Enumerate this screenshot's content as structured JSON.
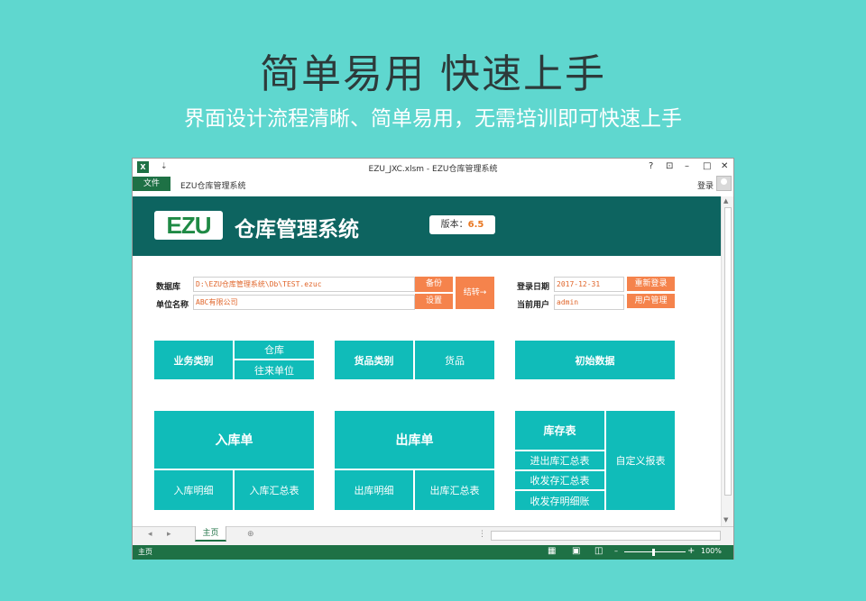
{
  "promo": {
    "headline": "简单易用  快速上手",
    "subline": "界面设计流程清晰、简单易用，无需培训即可快速上手"
  },
  "window": {
    "app_icon": "X",
    "quick_access": "⇣",
    "title": "EZU_JXC.xlsm - EZU仓库管理系统",
    "controls": {
      "help": "?",
      "ribbon_display": "⊡",
      "minimize": "–",
      "maximize": "□",
      "close": "✕"
    }
  },
  "ribbon": {
    "file_tab": "文件",
    "custom_tab": "EZU仓库管理系统",
    "login_label": "登录"
  },
  "banner": {
    "logo_text": "EZU",
    "title": "仓库管理系统",
    "version_label": "版本：",
    "version_value": "6.5"
  },
  "form": {
    "db_label": "数据库",
    "db_value": "D:\\EZU仓库管理系统\\Db\\TEST.ezuc",
    "company_label": "单位名称",
    "company_value": "ABC有限公司",
    "backup_btn": "备份",
    "settings_btn": "设置",
    "close_period_btn": "结转→",
    "login_date_label": "登录日期",
    "login_date_value": "2017-12-31",
    "current_user_label": "当前用户",
    "current_user_value": "admin",
    "relogin_btn": "重新登录",
    "user_mgmt_btn": "用户管理"
  },
  "menu": {
    "biz_category": "业务类别",
    "warehouse": "仓库",
    "partner": "往来单位",
    "goods_category": "货品类别",
    "goods": "货品",
    "initial_data": "初始数据",
    "inbound_order": "入库单",
    "inbound_detail": "入库明细",
    "inbound_summary": "入库汇总表",
    "outbound_order": "出库单",
    "outbound_detail": "出库明细",
    "outbound_summary": "出库汇总表",
    "stock_report": "库存表",
    "io_summary": "进出库汇总表",
    "rs_summary": "收发存汇总表",
    "rs_detail": "收发存明细账",
    "custom_report": "自定义报表"
  },
  "sheet_tabs": {
    "nav_prev": "◂",
    "nav_next": "▸",
    "active_tab": "主页",
    "add_tab": "⊕",
    "more": "⋮"
  },
  "status": {
    "text": "主页",
    "view_normal": "▦",
    "view_layout": "▣",
    "view_page_break": "◫",
    "zoom_minus": "–",
    "zoom_plus": "+",
    "zoom_level": "100%"
  },
  "colors": {
    "teal_button": "#10bcb9",
    "orange_button": "#f5834c",
    "banner": "#0d6460",
    "excel_green": "#1e7145",
    "background": "#5fd7cf"
  }
}
